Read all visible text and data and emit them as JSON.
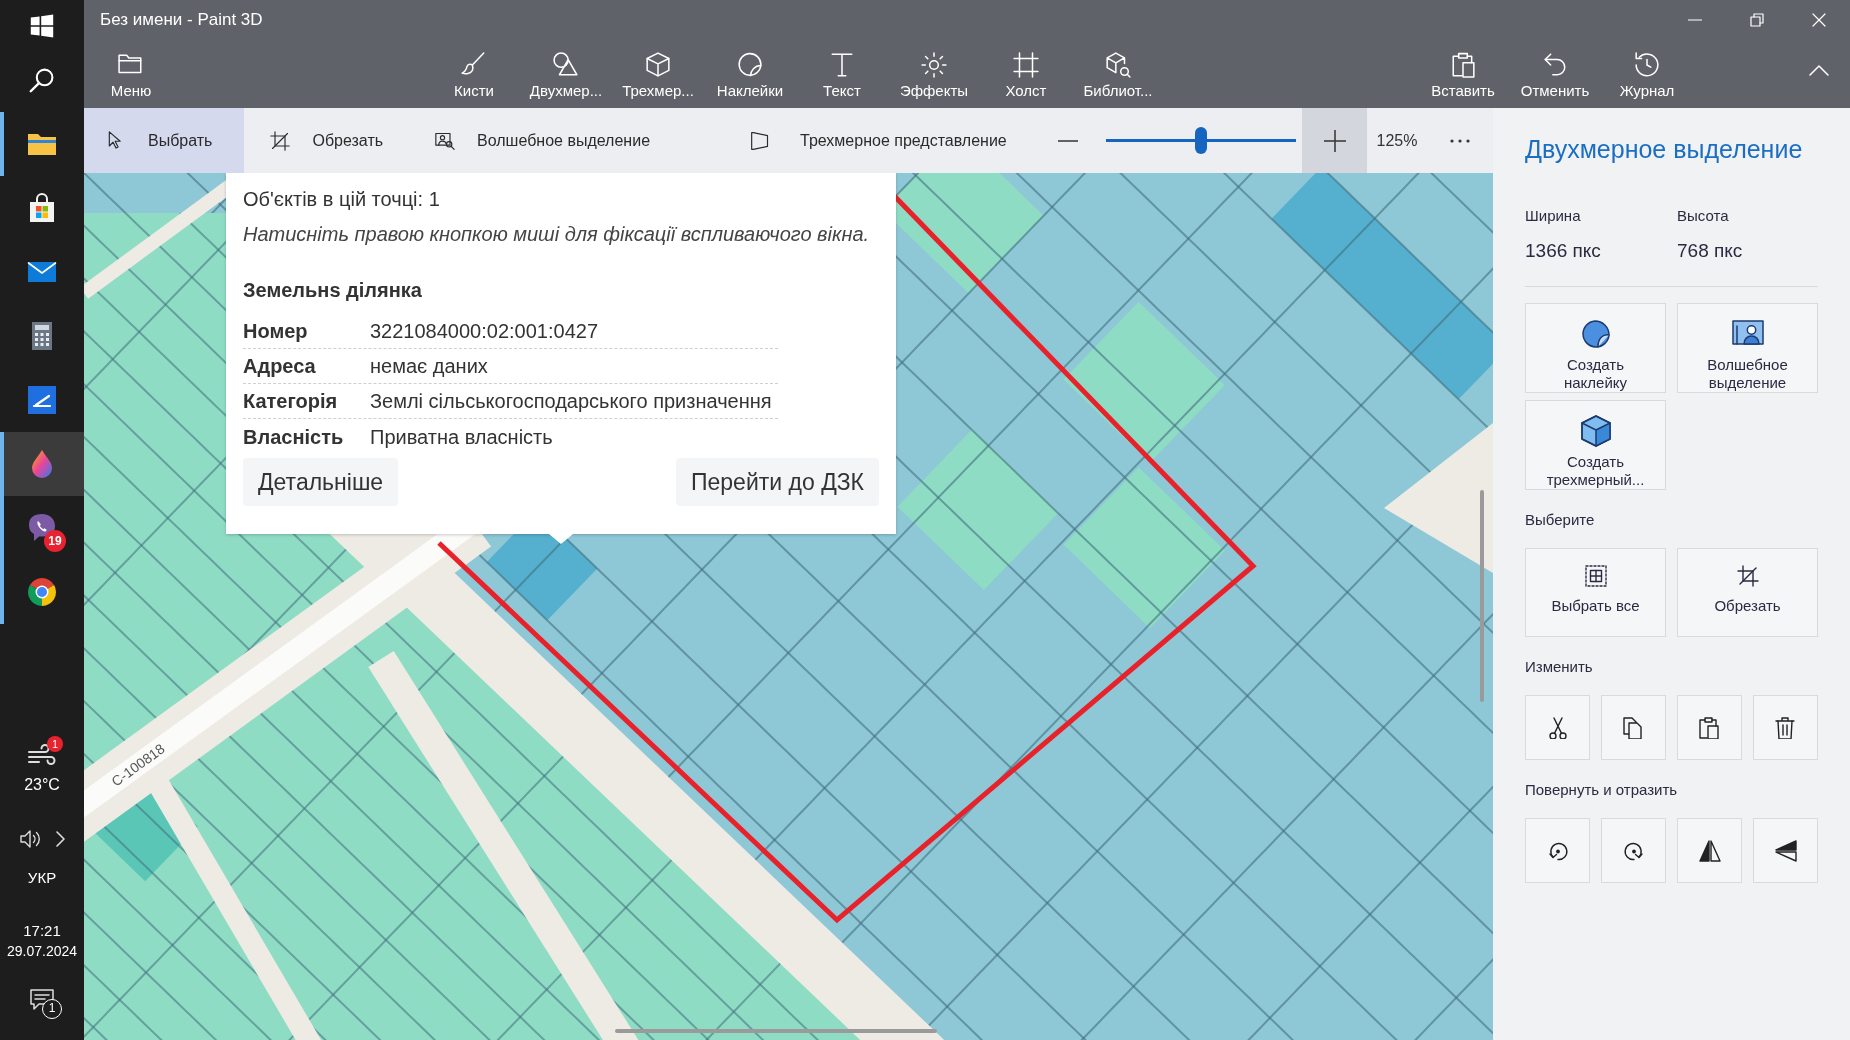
{
  "taskbar": {
    "apps": [
      {
        "kind": "folder",
        "running": true,
        "active": false
      },
      {
        "kind": "store",
        "running": false,
        "active": false
      },
      {
        "kind": "mail",
        "running": false,
        "active": false
      },
      {
        "kind": "calculator",
        "running": false,
        "active": false
      },
      {
        "kind": "scanner",
        "running": false,
        "active": false
      },
      {
        "kind": "paint3d",
        "running": true,
        "active": true
      },
      {
        "kind": "viber",
        "running": true,
        "active": false,
        "badge": "19"
      },
      {
        "kind": "chrome",
        "running": true,
        "active": false
      }
    ],
    "tray": {
      "weather": {
        "badge": "1",
        "temperature": "23°C"
      },
      "language": "УКР",
      "clock": {
        "time": "17:21",
        "date": "29.07.2024"
      },
      "notifications": {
        "badge": "1"
      }
    }
  },
  "window": {
    "title": "Без имени - Paint 3D"
  },
  "toolbar": {
    "menu": "Меню",
    "tools": [
      {
        "kind": "brushes",
        "label": "Кисти"
      },
      {
        "kind": "shapes2d",
        "label": "Двухмер..."
      },
      {
        "kind": "shapes3d",
        "label": "Трехмер..."
      },
      {
        "kind": "stickers",
        "label": "Наклейки"
      },
      {
        "kind": "text",
        "label": "Текст"
      },
      {
        "kind": "effects",
        "label": "Эффекты"
      },
      {
        "kind": "canvas",
        "label": "Холст"
      },
      {
        "kind": "library",
        "label": "Библиот..."
      }
    ],
    "actions": [
      {
        "kind": "paste",
        "label": "Вставить"
      },
      {
        "kind": "undo",
        "label": "Отменить"
      },
      {
        "kind": "history",
        "label": "Журнал"
      }
    ]
  },
  "selection_bar": {
    "tools": [
      {
        "kind": "select",
        "label": "Выбрать",
        "selected": true
      },
      {
        "kind": "crop",
        "label": "Обрезать",
        "selected": false
      },
      {
        "kind": "magic_select",
        "label": "Волшебное выделение",
        "selected": false
      },
      {
        "kind": "view_3d",
        "label": "Трехмерное представление",
        "selected": false
      }
    ],
    "zoom": {
      "level": 0.5,
      "reading": "125%"
    }
  },
  "canvas": {
    "popup": {
      "count": "Об'єктів в цій точці: 1",
      "hint": "Натисніть правою кнопкою миші для фіксації вспливаючого вікна.",
      "heading": "Земельнs ділянка",
      "rows": [
        {
          "label": "Номер",
          "value": "3221084000:02:001:0427"
        },
        {
          "label": "Адреса",
          "value": "немає даних"
        },
        {
          "label": "Категорія",
          "value": "Землі сільськогосподарського призначення"
        },
        {
          "label": "Власність",
          "value": "Приватна власність"
        }
      ],
      "buttons": [
        "Детальніше",
        "Перейти до ДЗК"
      ]
    },
    "road_label": "С-100818"
  },
  "panel": {
    "title": "Двухмерное выделение",
    "size": [
      {
        "label": "Ширина",
        "value": "1366 пкс"
      },
      {
        "label": "Высота",
        "value": "768 пкс"
      }
    ],
    "actions": [
      {
        "kind": "sticker",
        "label": "Создать наклейку"
      },
      {
        "kind": "magic_select",
        "label": "Волшебное выделение"
      },
      {
        "kind": "make_3d",
        "label": "Создать трехмерный..."
      }
    ],
    "sections": [
      {
        "title": "Выберите",
        "buttons": [
          {
            "kind": "select_all",
            "label": "Выбрать все"
          },
          {
            "kind": "crop",
            "label": "Обрезать"
          }
        ]
      },
      {
        "title": "Изменить",
        "buttons": [
          {
            "kind": "cut"
          },
          {
            "kind": "copy"
          },
          {
            "kind": "paste"
          },
          {
            "kind": "delete"
          }
        ]
      },
      {
        "title": "Повернуть и отразить",
        "buttons": [
          {
            "kind": "rotate_left"
          },
          {
            "kind": "rotate_right"
          },
          {
            "kind": "flip_vertical"
          },
          {
            "kind": "flip_horizontal"
          }
        ]
      }
    ]
  }
}
